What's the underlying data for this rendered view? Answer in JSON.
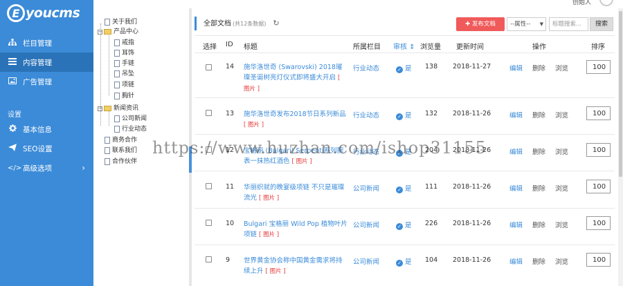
{
  "app": {
    "logo_letter": "E",
    "logo_word": "youcms",
    "user_label": "创始人"
  },
  "sidebar": {
    "items": [
      {
        "label": "栏目管理",
        "icon": "sitemap-icon"
      },
      {
        "label": "内容管理",
        "icon": "list-icon",
        "active": true
      },
      {
        "label": "广告管理",
        "icon": "image-icon"
      }
    ],
    "section_label": "设置",
    "settings": [
      {
        "label": "基本信息",
        "icon": "gear-icon"
      },
      {
        "label": "SEO设置",
        "icon": "paper-plane-icon"
      },
      {
        "label": "高级选项",
        "icon": "code-icon",
        "arrow": "›"
      }
    ]
  },
  "tree": {
    "nodes": [
      {
        "label": "关于我们"
      },
      {
        "label": "产品中心"
      },
      {
        "label": "戒指"
      },
      {
        "label": "耳饰"
      },
      {
        "label": "手链"
      },
      {
        "label": "吊坠"
      },
      {
        "label": "项链"
      },
      {
        "label": "胸针"
      },
      {
        "label": "新闻资讯"
      },
      {
        "label": "公司新闻"
      },
      {
        "label": "行业动态"
      },
      {
        "label": "商务合作"
      },
      {
        "label": "联系我们"
      },
      {
        "label": "合作伙伴"
      }
    ]
  },
  "main": {
    "heading": "全部文档",
    "count": "(共12条数据)",
    "add_button": "发布文档",
    "attr_select": "--属性--",
    "search_placeholder": "标题搜索...",
    "search_button": "搜索",
    "headers": {
      "select": "选择",
      "id": "ID",
      "title": "标题",
      "column": "所属栏目",
      "review": "审核",
      "views": "浏览量",
      "updated": "更新时间",
      "action": "操作",
      "sort": "排序"
    },
    "rows": [
      {
        "id": "14",
        "title": "施华洛世奇 (Swarovski) 2018璀璨圣诞树亮灯仪式即将盛大开启",
        "tag": "[ 图片 ]",
        "column": "行业动态",
        "review": "是",
        "views": "138",
        "date": "2018-11-27",
        "edit": "编辑",
        "del": "删除",
        "view": "浏览",
        "sort": "100"
      },
      {
        "id": "13",
        "title": "施华洛世奇发布2018节日系列新品",
        "tag": "[ 图片 ]",
        "column": "行业动态",
        "review": "是",
        "views": "132",
        "date": "2018-11-26",
        "edit": "编辑",
        "del": "删除",
        "view": "浏览",
        "sort": "100"
      },
      {
        "id": "12",
        "title": "宝格丽 (Bulgari) Serpenti系列腕表一抹热红酒色",
        "tag": "[ 图片 ]",
        "column": "行业动态",
        "review": "是",
        "views": "204",
        "date": "2018-11-26",
        "edit": "编辑",
        "del": "删除",
        "view": "浏览",
        "sort": "100"
      },
      {
        "id": "11",
        "title": "华丽织就的晚宴级项链 不只是璀璨流光",
        "tag": "[ 图片 ]",
        "column": "公司新闻",
        "review": "是",
        "views": "111",
        "date": "2018-11-26",
        "edit": "编辑",
        "del": "删除",
        "view": "浏览",
        "sort": "100"
      },
      {
        "id": "10",
        "title": "Bulgari 宝格丽 Wild Pop 植物叶片项链",
        "tag": "[ 图片 ]",
        "column": "公司新闻",
        "review": "是",
        "views": "226",
        "date": "2018-11-26",
        "edit": "编辑",
        "del": "删除",
        "view": "浏览",
        "sort": "100"
      },
      {
        "id": "9",
        "title": "世界黄金协会称中国黄金需求将持续上升",
        "tag": "[ 图片 ]",
        "column": "公司新闻",
        "review": "是",
        "views": "104",
        "date": "2018-11-26",
        "edit": "编辑",
        "del": "删除",
        "view": "浏览",
        "sort": "100"
      }
    ]
  },
  "watermark": "https://www.huzhan.com/ishop31155",
  "colors": {
    "sidebar": "#3b8bd8",
    "sidebar_active": "#2b73b8",
    "accent": "#3b8bd8",
    "add_button": "#f05a5a",
    "tag": "#e53333"
  }
}
